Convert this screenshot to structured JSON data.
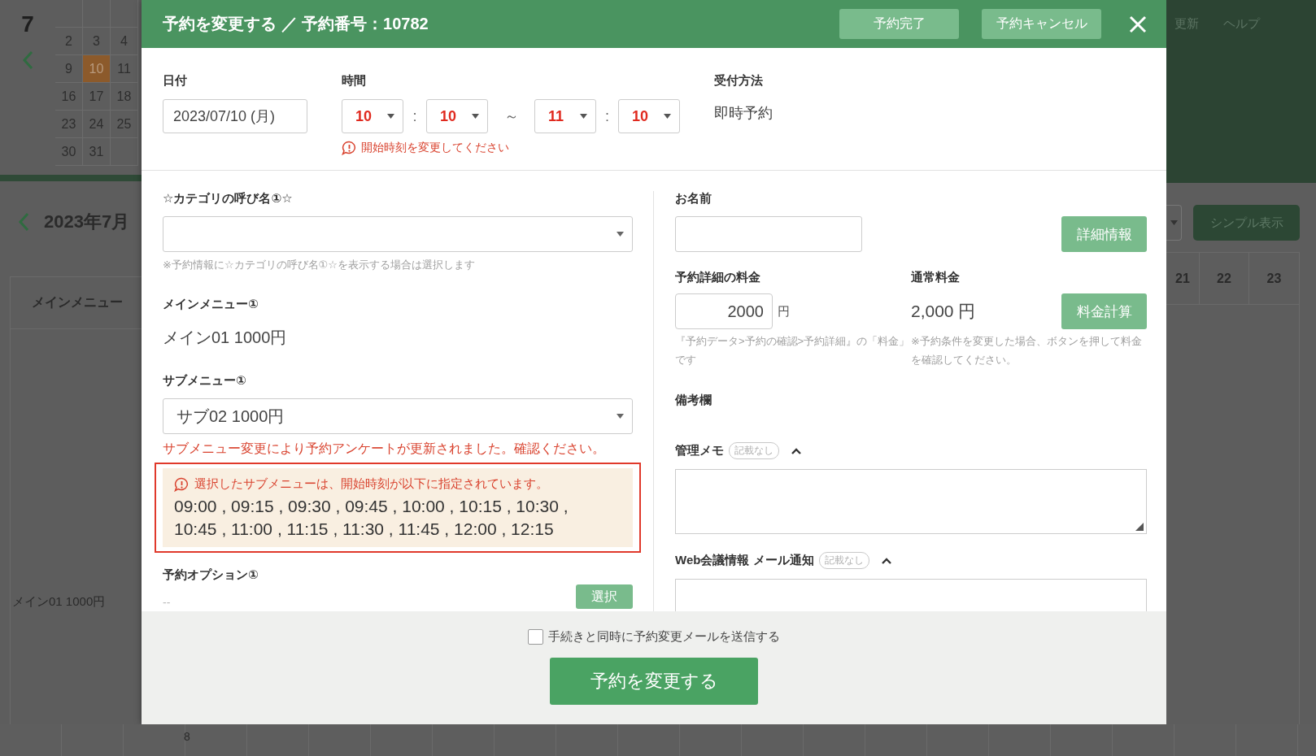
{
  "background": {
    "calendar": {
      "month": "7",
      "days": [
        {
          "label": "2",
          "selected": false
        },
        {
          "label": "3",
          "selected": false
        },
        {
          "label": "4",
          "selected": false
        },
        {
          "label": "9",
          "selected": false
        },
        {
          "label": "10",
          "selected": true
        },
        {
          "label": "11",
          "selected": false
        },
        {
          "label": "16",
          "selected": false
        },
        {
          "label": "17",
          "selected": false
        },
        {
          "label": "18",
          "selected": false
        },
        {
          "label": "23",
          "selected": false
        },
        {
          "label": "24",
          "selected": false
        },
        {
          "label": "25",
          "selected": false
        },
        {
          "label": "30",
          "selected": false
        },
        {
          "label": "31",
          "selected": false
        }
      ]
    },
    "schedule_title": "2023年7月",
    "column_header": "メインメニュー",
    "row_label": "メイン01 1000円",
    "row_hour": "8",
    "header_links": [
      "更新",
      "ヘルプ"
    ],
    "view_button": "シンプル表示",
    "hour_headers": [
      "21",
      "22",
      "23"
    ]
  },
  "modal": {
    "title": "予約を変更する ／ 予約番号：10782",
    "header_buttons": [
      "予約完了",
      "予約キャンセル"
    ],
    "date": {
      "label": "日付",
      "value": "2023/07/10 (月)"
    },
    "time": {
      "label": "時間",
      "fields": [
        "10",
        "10",
        "11",
        "10"
      ],
      "separators": [
        ":",
        "～",
        ":"
      ],
      "error": "開始時刻を変更してください"
    },
    "reception": {
      "label": "受付方法",
      "value": "即時予約"
    },
    "category": {
      "label": "☆カテゴリの呼び名①☆",
      "hint": "※予約情報に☆カテゴリの呼び名①☆を表示する場合は選択します"
    },
    "main_menu": {
      "label": "メインメニュー①",
      "value": "メイン01 1000円"
    },
    "sub_menu": {
      "label": "サブメニュー①",
      "value": "サブ02 1000円",
      "notice": "サブメニュー変更により予約アンケートが更新されました。確認ください。"
    },
    "alert": {
      "message": "選択したサブメニューは、開始時刻が以下に指定されています。",
      "time_lines": [
        "09:00 , 09:15 , 09:30 , 09:45 , 10:00 , 10:15 , 10:30 ,",
        "10:45 , 11:00 , 11:15 , 11:30 , 11:45 , 12:00 , 12:15"
      ]
    },
    "option": {
      "label": "予約オプション①",
      "value": "--",
      "button": "選択"
    },
    "name": {
      "label": "お名前",
      "button": "詳細情報"
    },
    "price": {
      "label": "予約詳細の料金",
      "value": "2000",
      "unit": "円",
      "hint": "『予約データ>予約の確認>予約詳細』の「料金」です"
    },
    "regular_price": {
      "label": "通常料金",
      "value": "2,000 円",
      "button": "料金計算",
      "hint": "※予約条件を変更した場合、ボタンを押して料金を確認してください。"
    },
    "remarks": {
      "label": "備考欄"
    },
    "memo": {
      "label": "管理メモ",
      "badge": "記載なし",
      "expanded": true
    },
    "web_meeting": {
      "label": "Web会議情報 メール通知",
      "badge": "記載なし",
      "expanded": true
    },
    "footer": {
      "send_mail": {
        "label": "手続きと同時に予約変更メールを送信する",
        "checked": false
      },
      "submit": "予約を変更する"
    }
  }
}
